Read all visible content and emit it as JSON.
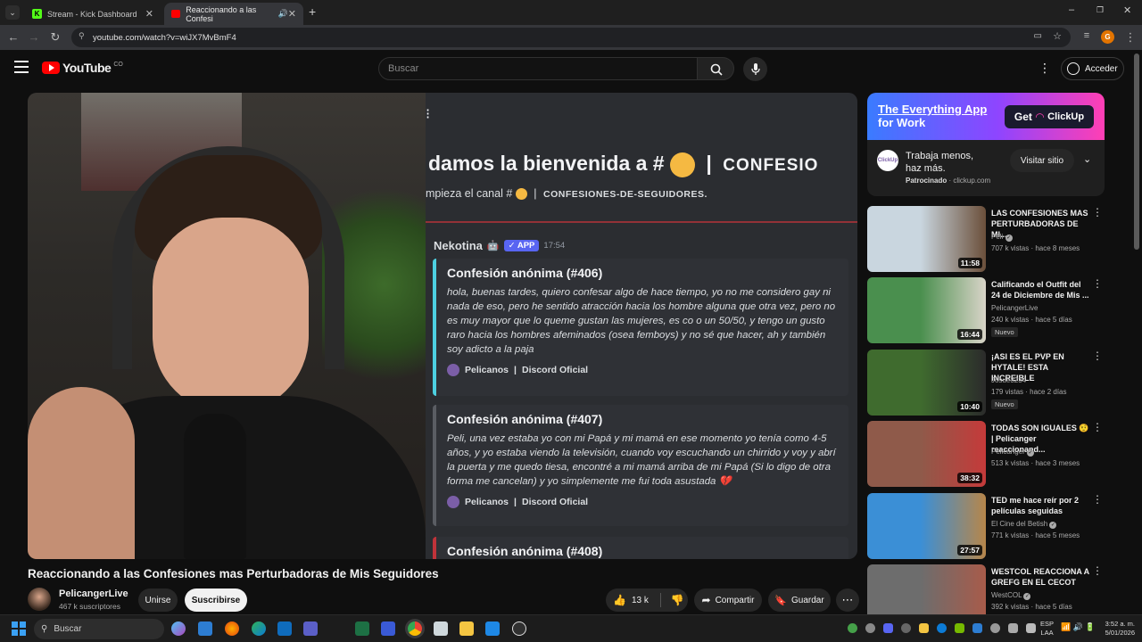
{
  "browser": {
    "tabs": [
      {
        "title": "Stream - Kick Dashboard",
        "active": false
      },
      {
        "title": "Reaccionando a las Confesi",
        "active": true
      }
    ],
    "url": "youtube.com/watch?v=wiJX7MvBmF4",
    "profile_initial": "G",
    "accent_color": "#e37400"
  },
  "youtube": {
    "logo_text": "YouTube",
    "country": "CO",
    "search_placeholder": "Buscar",
    "signin_label": "Acceder"
  },
  "video": {
    "discord_heading": "damos la bienvenida a #",
    "discord_heading_tag": "CONFESIO",
    "discord_sub": "mpieza el canal #",
    "discord_sub_tag": "CONFESIONES-DE-SEGUIDORES.",
    "bot_name": "Nekotina",
    "bot_badge": "APP",
    "bot_time": "17:54",
    "messages": [
      {
        "title": "Confesión anónima (#406)",
        "body": "hola, buenas tardes, quiero confesar algo de hace tiempo, yo no me considero gay ni nada de eso, pero he sentido atracción hacia los hombre alguna que otra vez, pero no es muy mayor que lo queme gustan las mujeres, es co o un 50/50, y tengo un gusto raro hacia los hombres afeminados (osea femboys) y no sé que hacer, ah y también soy adicto a la paja",
        "footer_server": "Pelicanos",
        "footer_channel": "Discord Oficial"
      },
      {
        "title": "Confesión anónima (#407)",
        "body": "Peli, una vez estaba yo con mi Papá y mi mamá en ese momento yo tenía como 4-5 años, y yo estaba viendo la televisión, cuando voy escuchando un chirrido y voy y abrí la puerta y me quedo tiesa, encontré a mi mamá arriba de mi Papá (Si lo digo de otra forma me cancelan) y yo simplemente me fui toda asustada 💔",
        "footer_server": "Pelicanos",
        "footer_channel": "Discord Oficial"
      },
      {
        "title": "Confesión anónima (#408)",
        "body": "",
        "footer_server": "",
        "footer_channel": ""
      }
    ],
    "title": "Reaccionando a las Confesiones mas Perturbadoras de Mis Seguidores",
    "channel_name": "PelicangerLive",
    "subscribers": "467 k suscriptores",
    "join_label": "Unirse",
    "subscribe_label": "Suscribirse",
    "likes": "13 k",
    "share_label": "Compartir",
    "save_label": "Guardar"
  },
  "ad": {
    "banner_line1": "The Everything App",
    "banner_line2": "for Work",
    "banner_cta": "Get",
    "banner_brand": "ClickUp",
    "text": "Trabaja menos, haz más.",
    "sponsored": "Patrocinado",
    "domain": "clickup.com",
    "button": "Visitar sitio"
  },
  "recommendations": [
    {
      "title": "LAS CONFESIONES MAS PERTURBADORAS DE MI...",
      "channel": "Peli",
      "verified": true,
      "meta": "707 k vistas · hace 8 meses",
      "duration": "11:58",
      "badge": "",
      "thumb_a": "#c9d6df",
      "thumb_b": "#6b4f3a"
    },
    {
      "title": "Calificando el Outfit del 24 de Diciembre de Mis ...",
      "channel": "PelicangerLive",
      "verified": false,
      "meta": "240 k vistas · hace 5 días",
      "duration": "16:44",
      "badge": "Nuevo",
      "thumb_a": "#4a8f4e",
      "thumb_b": "#d9d4c8"
    },
    {
      "title": "¡ASI ES EL PVP EN HYTALE! ESTA INCREIBLE",
      "channel": "Josue3234",
      "verified": false,
      "meta": "179 vistas · hace 2 días",
      "duration": "10:40",
      "badge": "Nuevo",
      "thumb_a": "#3f6b2e",
      "thumb_b": "#2b2b2b"
    },
    {
      "title": "TODAS SON IGUALES 🤨 | Pelicanger reaccionand...",
      "channel": "Pelicanger",
      "verified": true,
      "meta": "513 k vistas · hace 3 meses",
      "duration": "38:32",
      "badge": "",
      "thumb_a": "#8f5a4a",
      "thumb_b": "#c53a3a"
    },
    {
      "title": "TED me hace reír por 2 películas seguidas",
      "channel": "El Cine del Betish",
      "verified": true,
      "meta": "771 k vistas · hace 5 meses",
      "duration": "27:57",
      "badge": "",
      "thumb_a": "#3b8fd6",
      "thumb_b": "#b7864a"
    },
    {
      "title": "WESTCOL REACCIONA A GREFG EN EL CECOT",
      "channel": "WestCOL",
      "verified": true,
      "meta": "392 k vistas · hace 5 días",
      "duration": "",
      "badge": "",
      "thumb_a": "#6d6d6d",
      "thumb_b": "#a85b4a"
    }
  ],
  "taskbar": {
    "search_placeholder": "Buscar",
    "lang": "ESP",
    "lang2": "LAA",
    "time": "3:52 a. m.",
    "date": "5/01/2026"
  }
}
